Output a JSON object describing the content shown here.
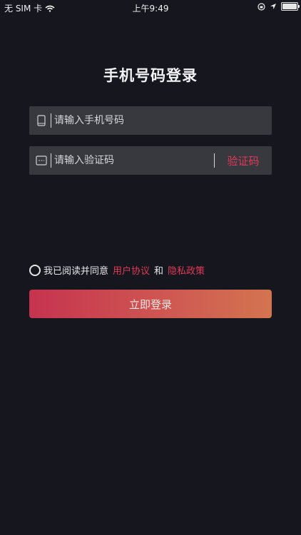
{
  "status_bar": {
    "carrier": "无 SIM 卡",
    "wifi_icon": "wifi-icon",
    "time": "上午9:49",
    "battery_level": 1.0
  },
  "page": {
    "title": "手机号码登录"
  },
  "phone_field": {
    "icon": "phone-icon",
    "placeholder": "请输入手机号码",
    "value": ""
  },
  "code_field": {
    "icon": "code-keypad-icon",
    "placeholder": "请输入验证码",
    "value": "",
    "button_label": "验证码"
  },
  "agreement": {
    "text": "我已阅读并同意",
    "terms_link": "用户协议",
    "conjunction": "和",
    "privacy_link": "隐私政策"
  },
  "login_button": {
    "label": "立即登录"
  },
  "colors": {
    "background": "#16161e",
    "field_background": "#38383f",
    "accent": "#e03a56",
    "button_gradient_start": "#c6334f",
    "button_gradient_end": "#d3744f"
  }
}
